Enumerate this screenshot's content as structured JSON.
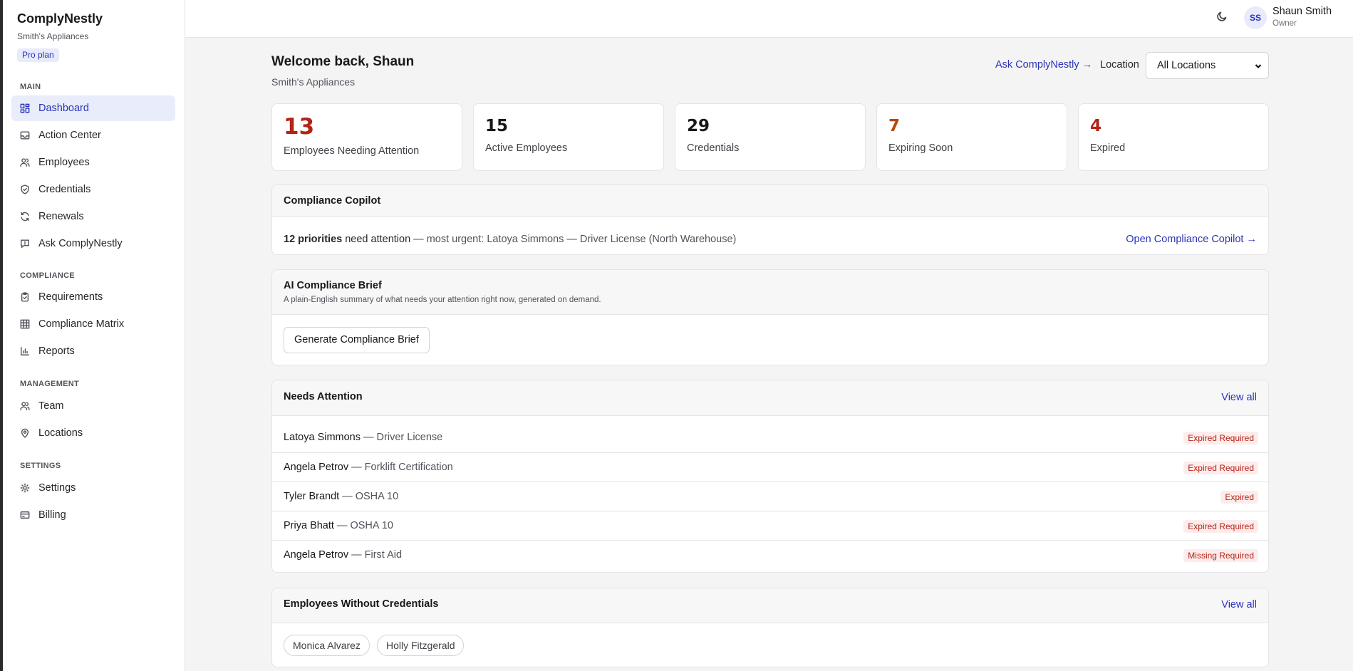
{
  "sidebar": {
    "brand": "ComplyNestly",
    "company": "Smith's Appliances",
    "plan": "Pro plan",
    "sections": {
      "main": "MAIN",
      "compliance": "COMPLIANCE",
      "management": "MANAGEMENT",
      "settings": "SETTINGS"
    },
    "items": {
      "dashboard": "Dashboard",
      "action_center": "Action Center",
      "employees": "Employees",
      "credentials": "Credentials",
      "renewals": "Renewals",
      "ask": "Ask ComplyNestly",
      "requirements": "Requirements",
      "matrix": "Compliance Matrix",
      "reports": "Reports",
      "team": "Team",
      "locations": "Locations",
      "settings": "Settings",
      "billing": "Billing"
    },
    "active_item": "dashboard"
  },
  "topbar": {
    "avatar_initials": "SS",
    "user_name": "Shaun Smith",
    "user_role": "Owner",
    "theme_icon": "moon-icon"
  },
  "header": {
    "title": "Welcome back, Shaun",
    "subtitle": "Smith's Appliances",
    "ask_link": "Ask ComplyNestly →",
    "location_label": "Location",
    "location_value": "All Locations"
  },
  "stats": [
    {
      "value": "13",
      "label": "Employees Needing Attention",
      "color": "#b42318"
    },
    {
      "value": "15",
      "label": "Active Employees",
      "color": "#18181b"
    },
    {
      "value": "29",
      "label": "Credentials",
      "color": "#18181b"
    },
    {
      "value": "7",
      "label": "Expiring Soon",
      "color": "#b54708"
    },
    {
      "value": "4",
      "label": "Expired",
      "color": "#b42318"
    }
  ],
  "copilot": {
    "title": "Compliance Copilot",
    "count": "12 priorities",
    "need": " need attention",
    "detail": " — most urgent: Latoya Simmons — Driver License (North Warehouse)",
    "link": "Open Compliance Copilot →"
  },
  "brief": {
    "title": "AI Compliance Brief",
    "subtitle": "A plain-English summary of what needs your attention right now, generated on demand.",
    "button": "Generate Compliance Brief"
  },
  "attention": {
    "title": "Needs Attention",
    "link": "View all",
    "rows": [
      {
        "name": "Latoya Simmons",
        "credential": " — Driver License",
        "status": "Expired Required"
      },
      {
        "name": "Angela Petrov",
        "credential": " — Forklift Certification",
        "status": "Expired Required"
      },
      {
        "name": "Tyler Brandt",
        "credential": " — OSHA 10",
        "status": "Expired"
      },
      {
        "name": "Priya Bhatt",
        "credential": " — OSHA 10",
        "status": "Expired Required"
      },
      {
        "name": "Angela Petrov",
        "credential": " — First Aid",
        "status": "Missing Required"
      }
    ]
  },
  "without_creds": {
    "title": "Employees Without Credentials",
    "link": "View all",
    "employees": [
      "Monica Alvarez",
      "Holly Fitzgerald"
    ]
  }
}
